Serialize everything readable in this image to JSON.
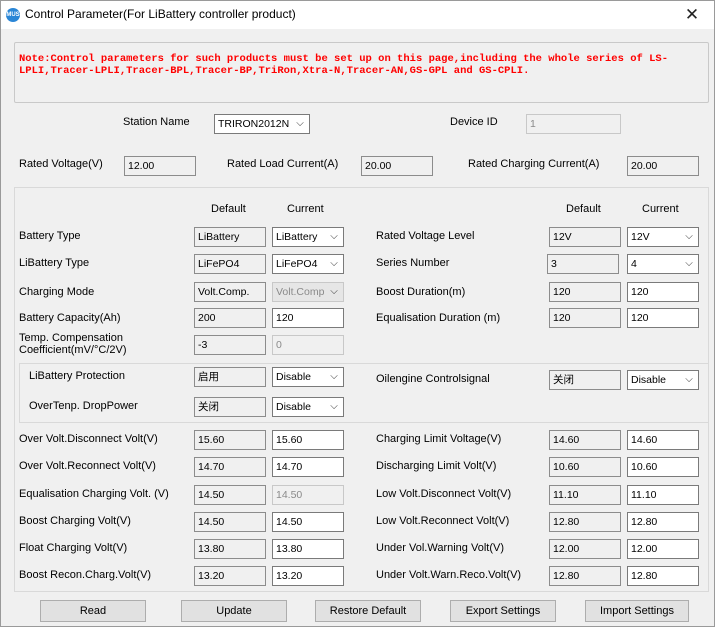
{
  "window": {
    "title": "Control Parameter(For LiBattery controller product)",
    "close_symbol": "✕",
    "icon_text": "MUS"
  },
  "note": "Note:Control parameters for such products must be set up on this page,including the whole series of LS-LPLI,Tracer-LPLI,Tracer-BPL,Tracer-BP,TriRon,Xtra-N,Tracer-AN,GS-GPL and GS-CPLI.",
  "colors": {
    "note": "#ff0000",
    "window_bg": "#f0f0f0"
  },
  "station": {
    "label": "Station Name",
    "value": "TRIRON2012N"
  },
  "device": {
    "label": "Device ID",
    "value": "1"
  },
  "rated": {
    "voltage_label": "Rated Voltage(V)",
    "voltage": "12.00",
    "load_label": "Rated Load Current(A)",
    "load": "20.00",
    "charging_label": "Rated Charging Current(A)",
    "charging": "20.00"
  },
  "headers": {
    "default": "Default",
    "current": "Current"
  },
  "left": {
    "battery_type": {
      "label": "Battery Type",
      "default": "LiBattery",
      "current": "LiBattery"
    },
    "libattery_type": {
      "label": "LiBattery Type",
      "default": "LiFePO4",
      "current": "LiFePO4"
    },
    "charging_mode": {
      "label": "Charging Mode",
      "default": "Volt.Comp.",
      "current": "Volt.Comp"
    },
    "battery_capacity": {
      "label": "Battery Capacity(Ah)",
      "default": "200",
      "current": "120"
    },
    "temp_comp": {
      "label1": "Temp. Compensation",
      "label2": "Coefficient(mV/°C/2V)",
      "default": "-3",
      "current": "0"
    }
  },
  "right": {
    "rated_voltage_level": {
      "label": "Rated Voltage Level",
      "default": "12V",
      "current": "12V"
    },
    "series_number": {
      "label": "Series Number",
      "default": "3",
      "current": "4"
    },
    "boost_duration": {
      "label": "Boost Duration(m)",
      "default": "120",
      "current": "120"
    },
    "equalisation_duration": {
      "label": "Equalisation Duration (m)",
      "default": "120",
      "current": "120"
    }
  },
  "protection": {
    "libattery_protection": {
      "label": "LiBattery Protection",
      "default": "启用",
      "current": "Disable"
    },
    "overtemp_droppower": {
      "label": "OverTenp. DropPower",
      "default": "关闭",
      "current": "Disable"
    },
    "oilengine": {
      "label": "Oilengine Controlsignal",
      "default": "关闭",
      "current": "Disable"
    }
  },
  "voltages_left": [
    {
      "label": "Over Volt.Disconnect Volt(V)",
      "default": "15.60",
      "current": "15.60",
      "disabled": false
    },
    {
      "label": "Over Volt.Reconnect Volt(V)",
      "default": "14.70",
      "current": "14.70",
      "disabled": false
    },
    {
      "label": "Equalisation Charging Volt. (V)",
      "default": "14.50",
      "current": "14.50",
      "disabled": true
    },
    {
      "label": "Boost Charging Volt(V)",
      "default": "14.50",
      "current": "14.50",
      "disabled": false
    },
    {
      "label": "Float Charging Volt(V)",
      "default": "13.80",
      "current": "13.80",
      "disabled": false
    },
    {
      "label": "Boost Recon.Charg.Volt(V)",
      "default": "13.20",
      "current": "13.20",
      "disabled": false
    }
  ],
  "voltages_right": [
    {
      "label": "Charging Limit Voltage(V)",
      "default": "14.60",
      "current": "14.60"
    },
    {
      "label": "Discharging Limit Volt(V)",
      "default": "10.60",
      "current": "10.60"
    },
    {
      "label": "Low Volt.Disconnect Volt(V)",
      "default": "11.10",
      "current": "11.10"
    },
    {
      "label": "Low Volt.Reconnect Volt(V)",
      "default": "12.80",
      "current": "12.80"
    },
    {
      "label": "Under Vol.Warning Volt(V)",
      "default": "12.00",
      "current": "12.00"
    },
    {
      "label": "Under Volt.Warn.Reco.Volt(V)",
      "default": "12.80",
      "current": "12.80"
    }
  ],
  "buttons": {
    "read": "Read",
    "update": "Update",
    "restore": "Restore Default",
    "export": "Export Settings",
    "import": "Import Settings"
  }
}
